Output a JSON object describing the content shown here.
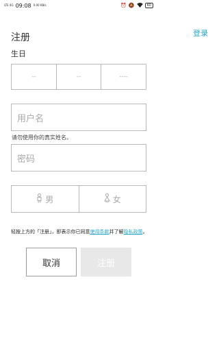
{
  "status_bar": {
    "network": "LTE\n4G",
    "time": "09:08",
    "data_rate": "0.00\nKB/s",
    "battery": "60"
  },
  "header": {
    "title": "注册",
    "login_link": "登录"
  },
  "birthday": {
    "label": "生日",
    "placeholders": [
      "--",
      "--",
      "----"
    ]
  },
  "username": {
    "placeholder": "用户名",
    "hint": "请勿使用你的真实姓名。"
  },
  "password": {
    "placeholder": "密码"
  },
  "gender": {
    "male": "男",
    "female": "女"
  },
  "terms": {
    "prefix": "轻按上方的「注册」，即表示你已同意",
    "terms_link": "使用条款",
    "middle": "并了解",
    "privacy_link": "隐私政策",
    "suffix": "。"
  },
  "buttons": {
    "cancel": "取消",
    "register": "注册"
  }
}
